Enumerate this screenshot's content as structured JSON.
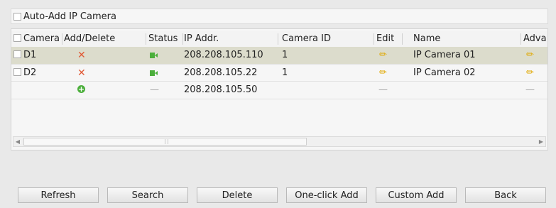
{
  "auto_add": {
    "label": "Auto-Add IP Camera",
    "checked": false
  },
  "columns": {
    "camera": "Camera",
    "add_delete": "Add/Delete",
    "status": "Status",
    "ip_addr": "IP Addr.",
    "camera_id": "Camera ID",
    "edit": "Edit",
    "name": "Name",
    "advanced": "Adva"
  },
  "rows": [
    {
      "camera": "D1",
      "action_icon": "delete-icon",
      "status_icon": "camera-online-icon",
      "ip": "208.208.105.110",
      "camera_id": "1",
      "edit_icon": "pencil-icon",
      "name": "IP Camera 01",
      "advanced_icon": "pencil-icon",
      "selected": true
    },
    {
      "camera": "D2",
      "action_icon": "delete-icon",
      "status_icon": "camera-online-icon",
      "ip": "208.208.105.22",
      "camera_id": "1",
      "edit_icon": "pencil-icon",
      "name": "IP Camera 02",
      "advanced_icon": "pencil-icon",
      "selected": false
    },
    {
      "camera": "",
      "action_icon": "add-icon",
      "status": "—",
      "ip": "208.208.105.50",
      "camera_id": "",
      "edit": "—",
      "name": "",
      "advanced": "—",
      "selected": false
    }
  ],
  "buttons": {
    "refresh": "Refresh",
    "search": "Search",
    "delete": "Delete",
    "one_click_add": "One-click Add",
    "custom_add": "Custom Add",
    "back": "Back"
  },
  "colors": {
    "selected_row": "#dcdccc",
    "delete_icon": "#e05a36",
    "status_online": "#4caf3c",
    "edit_pencil": "#e0a800"
  }
}
